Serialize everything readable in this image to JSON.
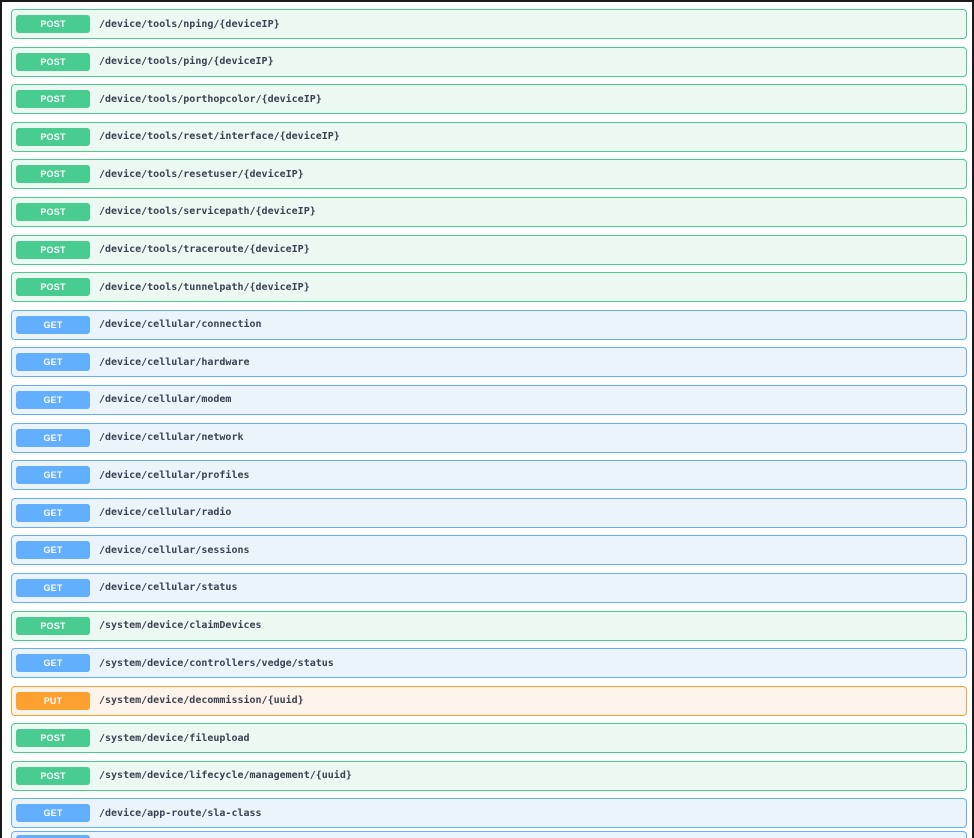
{
  "colors": {
    "post": "#49cc90",
    "get": "#61affe",
    "put": "#fca130"
  },
  "operations": [
    {
      "method": "POST",
      "path": "/device/tools/nping/{deviceIP}"
    },
    {
      "method": "POST",
      "path": "/device/tools/ping/{deviceIP}"
    },
    {
      "method": "POST",
      "path": "/device/tools/porthopcolor/{deviceIP}"
    },
    {
      "method": "POST",
      "path": "/device/tools/reset/interface/{deviceIP}"
    },
    {
      "method": "POST",
      "path": "/device/tools/resetuser/{deviceIP}"
    },
    {
      "method": "POST",
      "path": "/device/tools/servicepath/{deviceIP}"
    },
    {
      "method": "POST",
      "path": "/device/tools/traceroute/{deviceIP}"
    },
    {
      "method": "POST",
      "path": "/device/tools/tunnelpath/{deviceIP}"
    },
    {
      "method": "GET",
      "path": "/device/cellular/connection"
    },
    {
      "method": "GET",
      "path": "/device/cellular/hardware"
    },
    {
      "method": "GET",
      "path": "/device/cellular/modem"
    },
    {
      "method": "GET",
      "path": "/device/cellular/network"
    },
    {
      "method": "GET",
      "path": "/device/cellular/profiles"
    },
    {
      "method": "GET",
      "path": "/device/cellular/radio"
    },
    {
      "method": "GET",
      "path": "/device/cellular/sessions"
    },
    {
      "method": "GET",
      "path": "/device/cellular/status"
    },
    {
      "method": "POST",
      "path": "/system/device/claimDevices"
    },
    {
      "method": "GET",
      "path": "/system/device/controllers/vedge/status"
    },
    {
      "method": "PUT",
      "path": "/system/device/decommission/{uuid}"
    },
    {
      "method": "POST",
      "path": "/system/device/fileupload"
    },
    {
      "method": "POST",
      "path": "/system/device/lifecycle/management/{uuid}"
    },
    {
      "method": "GET",
      "path": "/device/app-route/sla-class"
    }
  ]
}
